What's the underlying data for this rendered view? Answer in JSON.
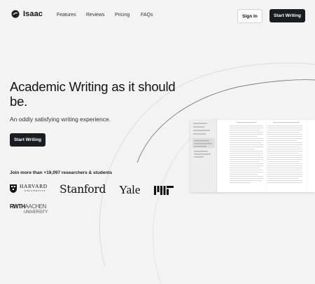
{
  "nav": {
    "brand": "Isaac",
    "links": [
      "Features",
      "Reviews",
      "Pricing",
      "FAQs"
    ],
    "sign_in": "Sign In",
    "start": "Start Writing"
  },
  "hero": {
    "headline": "Academic Writing as it should be.",
    "subhead": "An oddly satisfying writing experience.",
    "cta": "Start Writing"
  },
  "social_proof": {
    "join_text": "Join more than +19,097 researchers & students",
    "logos": {
      "harvard": "HARVARD",
      "harvard_sub": "UNIVERSITY",
      "stanford": "Stanford",
      "yale": "Yale",
      "rwth_1": "RWTH",
      "rwth_2": "AACHEN",
      "rwth_3": "UNIVERSITY"
    }
  },
  "icons": [
    "isaac-logo-icon",
    "harvard-shield-icon",
    "mit-logo-icon"
  ]
}
